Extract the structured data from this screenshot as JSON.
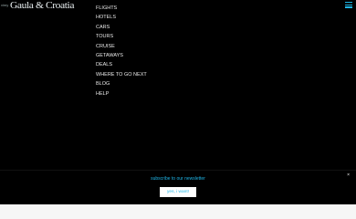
{
  "header": {
    "logo_prefix": "vimy",
    "logo": "Gaula & Croatia"
  },
  "nav": {
    "items": [
      {
        "label": "FLIGHTS"
      },
      {
        "label": "HOTELS"
      },
      {
        "label": "CARS"
      },
      {
        "label": "TOURS"
      },
      {
        "label": "CRUISE"
      },
      {
        "label": "GETAWAYS"
      },
      {
        "label": "DEALS"
      },
      {
        "label": "WHERE TO GO NEXT"
      },
      {
        "label": "BLOG"
      },
      {
        "label": "HELP"
      }
    ]
  },
  "banner": {
    "text": "subscribe to our newsletter",
    "button_label": "yes, i want!",
    "close_label": "×"
  },
  "colors": {
    "accent": "#1fb5e6",
    "background": "#000000"
  }
}
